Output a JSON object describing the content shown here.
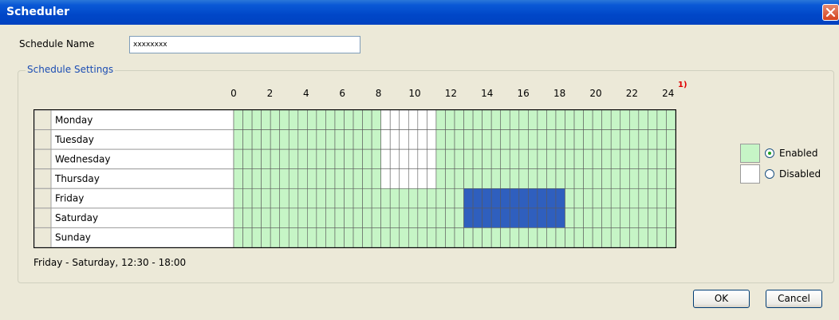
{
  "window": {
    "title": "Scheduler"
  },
  "form": {
    "name_label": "Schedule Name",
    "name_value": "xxxxxxxx",
    "settings_legend": "Schedule Settings",
    "footnote": "1)",
    "status_text": "Friday - Saturday, 12:30 - 18:00"
  },
  "hours": [
    "0",
    "2",
    "4",
    "6",
    "8",
    "10",
    "12",
    "14",
    "16",
    "18",
    "20",
    "22",
    "24"
  ],
  "days": [
    "Monday",
    "Tuesday",
    "Wednesday",
    "Thursday",
    "Friday",
    "Saturday",
    "Sunday"
  ],
  "schedule": {
    "slot_minutes": 30,
    "disabled": [
      {
        "days": [
          0,
          1,
          2,
          3
        ],
        "from": "08:00",
        "to": "11:00"
      }
    ],
    "selected": [
      {
        "days": [
          4,
          5
        ],
        "from": "12:30",
        "to": "18:00"
      }
    ]
  },
  "legend_items": [
    {
      "label": "Enabled",
      "color": "#c6f5c6",
      "checked": true
    },
    {
      "label": "Disabled",
      "color": "#ffffff",
      "checked": false
    }
  ],
  "colors": {
    "enabled": "#c6f5c6",
    "disabled": "#ffffff",
    "selected": "#2f5fbe",
    "grid_line": "#5a5a5a"
  },
  "buttons": {
    "ok": "OK",
    "cancel": "Cancel"
  }
}
